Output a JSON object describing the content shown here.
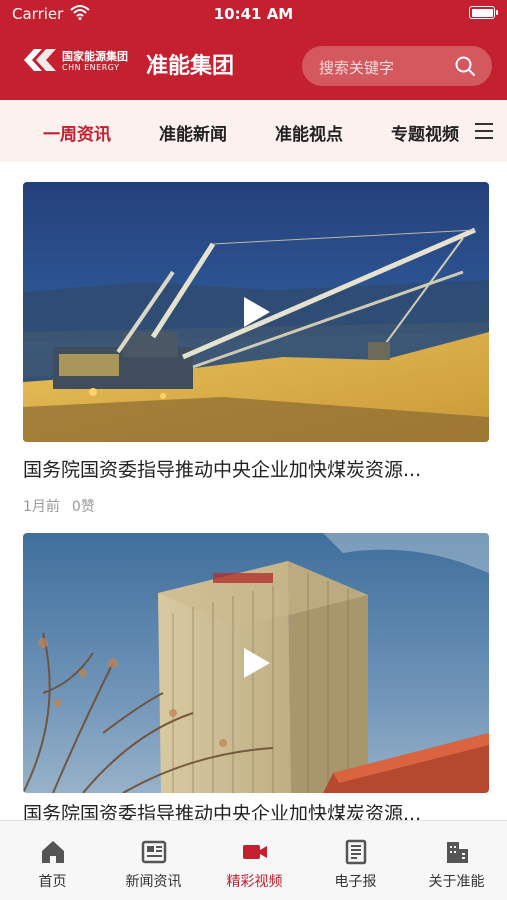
{
  "status_bar": {
    "carrier": "Carrier",
    "time": "10:41 AM"
  },
  "header": {
    "logo_cn": "国家能源集团",
    "logo_en": "CHN ENERGY",
    "brand": "准能集团",
    "search_placeholder": "搜索关键字",
    "accent_color": "#c4202f"
  },
  "tabs": [
    {
      "label": "一周资讯",
      "active": true
    },
    {
      "label": "准能新闻",
      "active": false
    },
    {
      "label": "准能视点",
      "active": false
    },
    {
      "label": "专题视频",
      "active": false
    }
  ],
  "feed": [
    {
      "title": "国务院国资委指导推动中央企业加快煤炭资源...",
      "time": "1月前",
      "likes": "0赞",
      "image": "mining-excavator-night"
    },
    {
      "title": "国务院国资委指导推动中央企业加快煤炭资源...",
      "image": "office-tower"
    }
  ],
  "nav": [
    {
      "label": "首页",
      "icon": "home-icon",
      "active": false
    },
    {
      "label": "新闻资讯",
      "icon": "news-icon",
      "active": false
    },
    {
      "label": "精彩视频",
      "icon": "video-camera-icon",
      "active": true
    },
    {
      "label": "电子报",
      "icon": "newspaper-icon",
      "active": false
    },
    {
      "label": "关于准能",
      "icon": "building-icon",
      "active": false
    }
  ]
}
